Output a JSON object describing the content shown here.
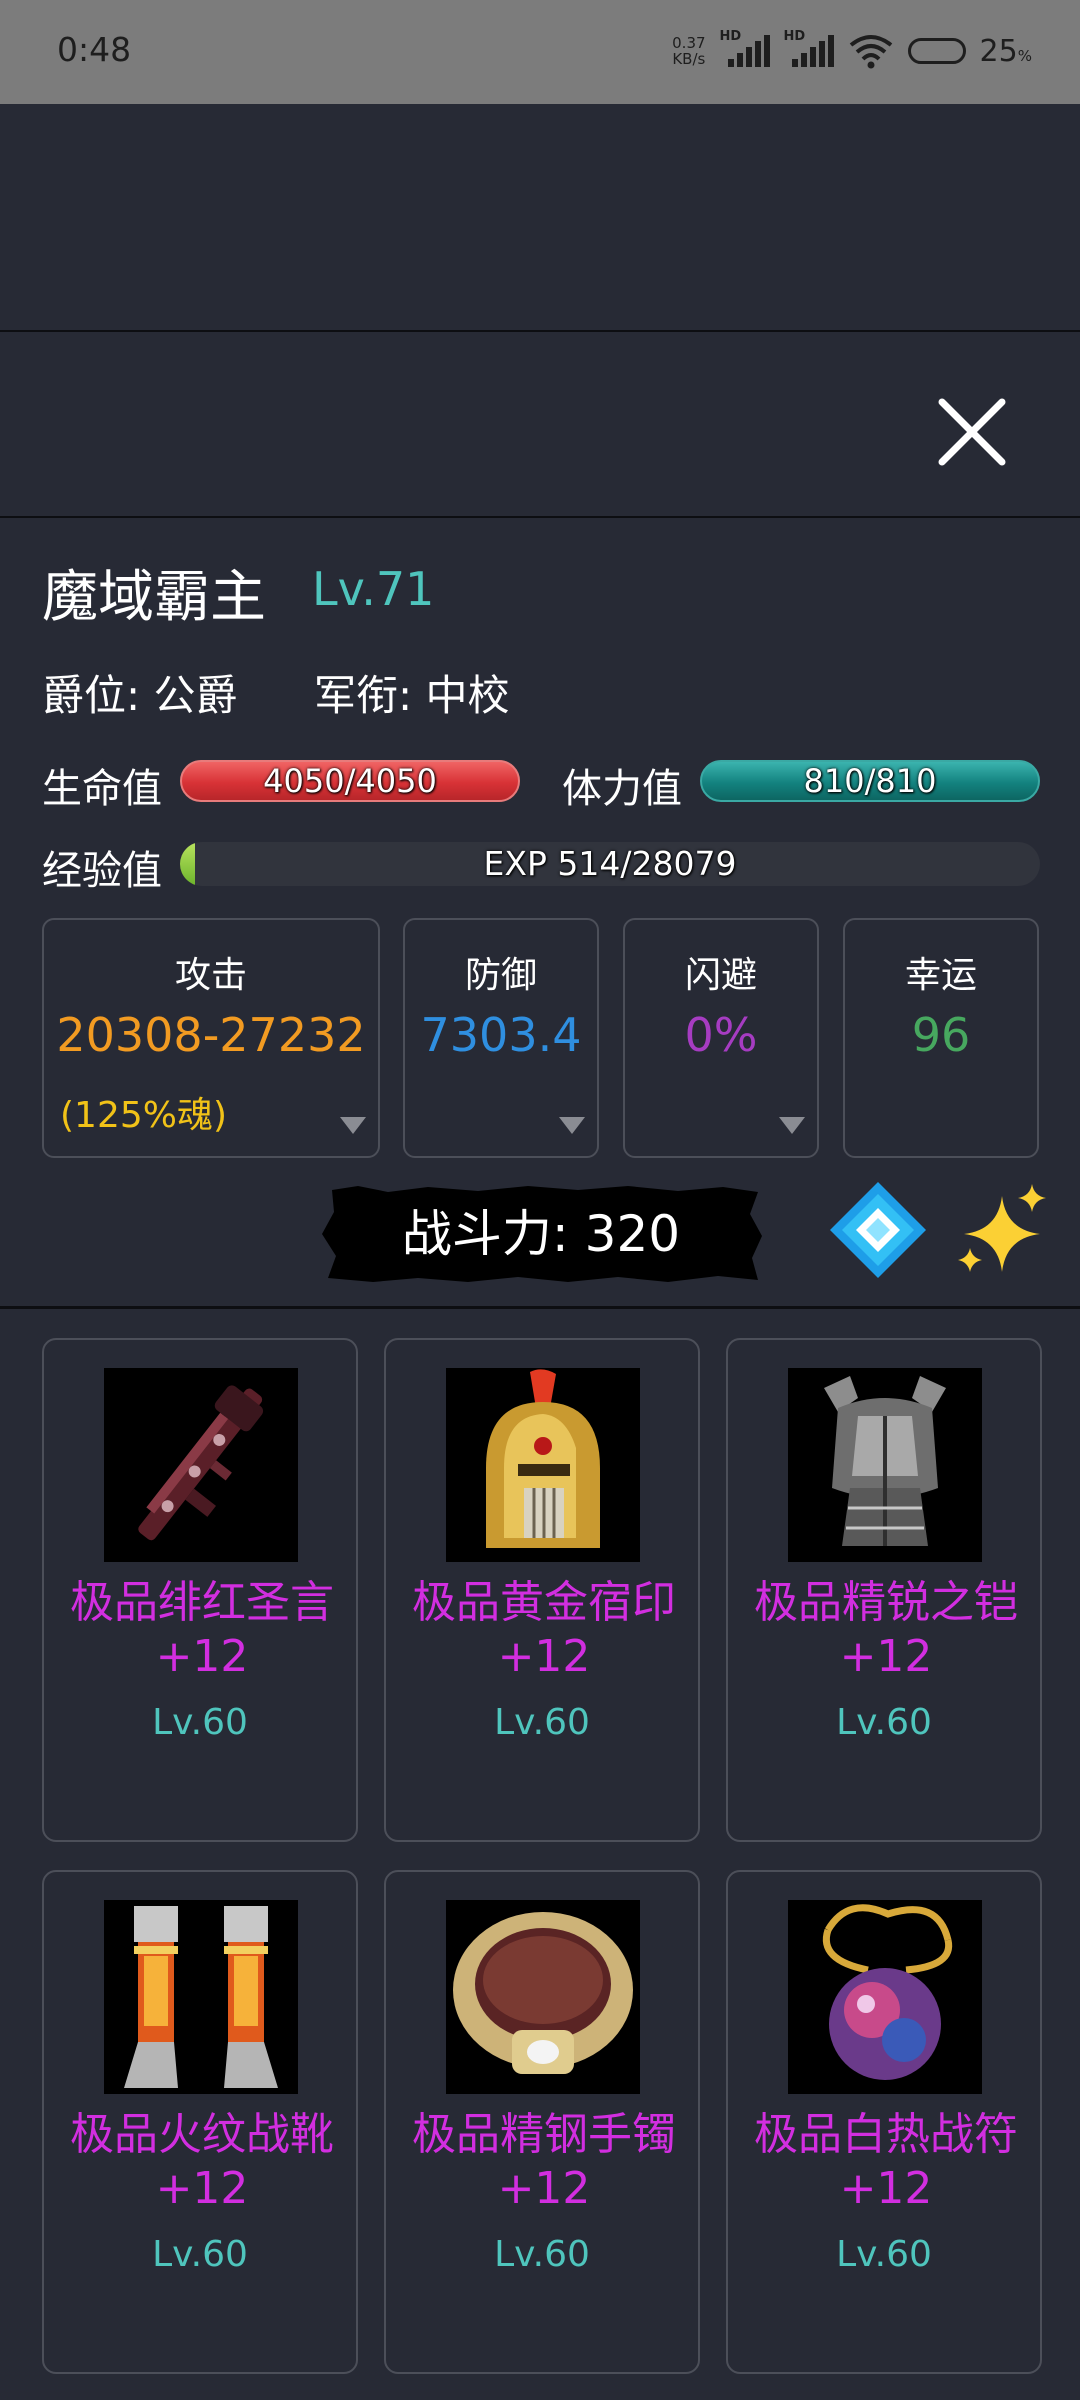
{
  "status_bar": {
    "time": "0:48",
    "net_speed_value": "0.37",
    "net_speed_unit": "KB/s",
    "signal1_label": "HD",
    "signal2_label": "HD",
    "battery_percent": "25",
    "battery_unit": "%"
  },
  "header": {
    "close_icon": "close-icon"
  },
  "character": {
    "name": "魔域霸主",
    "level": "Lv.71",
    "title_rank": "爵位: 公爵",
    "military_rank": "军衔: 中校"
  },
  "bars": {
    "hp_label": "生命值",
    "hp_text": "4050/4050",
    "hp_fraction": 1.0,
    "stamina_label": "体力值",
    "stamina_text": "810/810",
    "stamina_fraction": 1.0,
    "exp_label": "经验值",
    "exp_text": "EXP 514/28079",
    "exp_fraction": 0.018
  },
  "stats": {
    "attack": {
      "title": "攻击",
      "value": "20308-27232",
      "sub": "(125%魂)",
      "color": "#f29b22"
    },
    "defense": {
      "title": "防御",
      "value": "7303.4",
      "color": "#2f8fe0"
    },
    "dodge": {
      "title": "闪避",
      "value": "0%",
      "color": "#a63cc2"
    },
    "luck": {
      "title": "幸运",
      "value": "96",
      "color": "#47a85f"
    }
  },
  "power": {
    "text": "战斗力: 320"
  },
  "icons": {
    "gem": "gem-icon",
    "sparkle": "sparkle-icon",
    "dropdown": "triangle-down-icon"
  },
  "equipment": [
    {
      "name": "极品绯红圣言+12",
      "level": "Lv.60",
      "icon": "rifle-icon"
    },
    {
      "name": "极品黄金宿印+12",
      "level": "Lv.60",
      "icon": "golden-helmet-icon"
    },
    {
      "name": "极品精锐之铠+12",
      "level": "Lv.60",
      "icon": "armor-icon"
    },
    {
      "name": "极品火纹战靴+12",
      "level": "Lv.60",
      "icon": "boots-icon"
    },
    {
      "name": "极品精钢手镯+12",
      "level": "Lv.60",
      "icon": "ring-bracelet-icon"
    },
    {
      "name": "极品白热战符+12",
      "level": "Lv.60",
      "icon": "amulet-icon"
    }
  ],
  "colors": {
    "background": "#272a35",
    "accent_teal": "#4fc5bd",
    "item_name": "#d22ee0",
    "hp_red": "#d83236",
    "stamina_teal": "#13827f",
    "exp_green": "#6cb32c"
  }
}
